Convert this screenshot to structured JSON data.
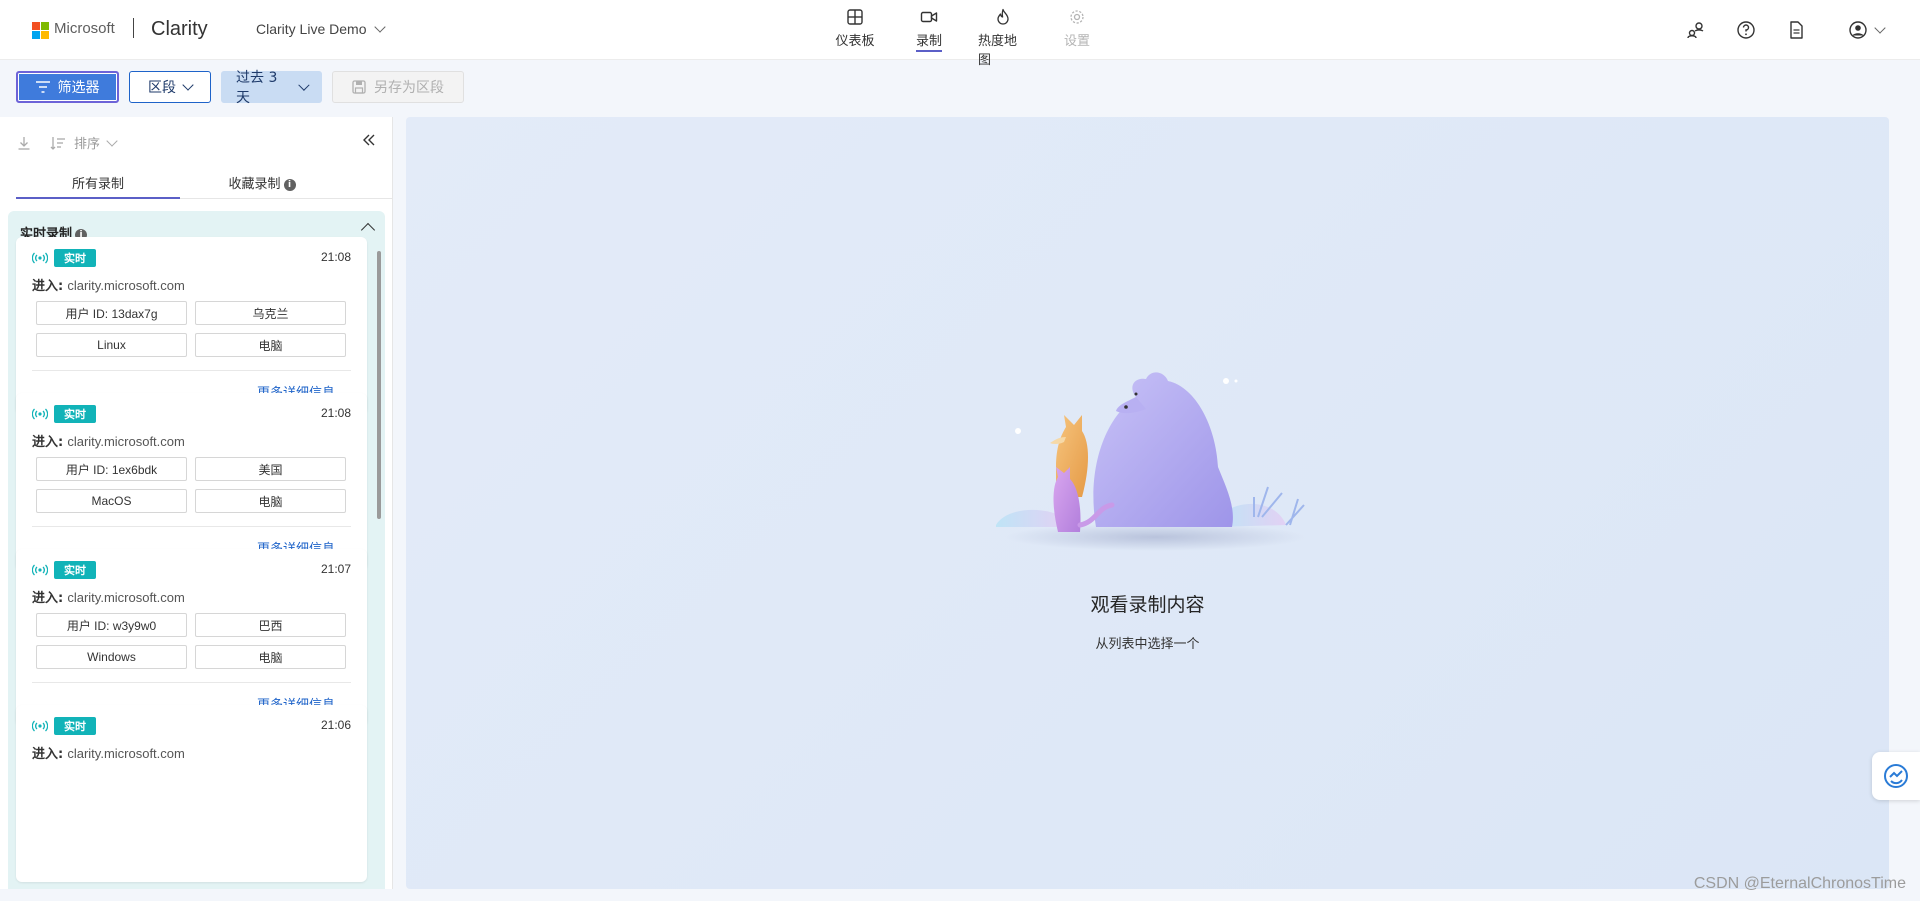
{
  "header": {
    "brand_ms": "Microsoft",
    "brand_app": "Clarity",
    "project": "Clarity Live Demo",
    "nav": [
      {
        "label": "仪表板",
        "icon": "dashboard-icon"
      },
      {
        "label": "录制",
        "icon": "video-icon",
        "active": true
      },
      {
        "label": "热度地图",
        "icon": "flame-icon"
      },
      {
        "label": "设置",
        "icon": "gear-icon",
        "disabled": true
      }
    ],
    "right_icons": [
      "share-people-icon",
      "help-icon",
      "document-icon",
      "account-icon"
    ]
  },
  "toolbar": {
    "filter_label": "筛选器",
    "segment_label": "区段",
    "range_label": "过去 3 天",
    "save_label": "另存为区段"
  },
  "sidebar": {
    "sort_label": "排序",
    "tabs": [
      {
        "label": "所有录制",
        "active": true
      },
      {
        "label": "收藏录制",
        "info": true
      }
    ],
    "live_section_title": "实时录制",
    "cards": [
      {
        "badge": "实时",
        "time": "21:08",
        "entry_label": "进入:",
        "url": "clarity.microsoft.com",
        "chips": [
          "用户 ID: 13dax7g",
          "乌克兰",
          "Linux",
          "电脑"
        ],
        "more": "更多详细信息"
      },
      {
        "badge": "实时",
        "time": "21:08",
        "entry_label": "进入:",
        "url": "clarity.microsoft.com",
        "chips": [
          "用户 ID: 1ex6bdk",
          "美国",
          "MacOS",
          "电脑"
        ],
        "more": "更多详细信息"
      },
      {
        "badge": "实时",
        "time": "21:07",
        "entry_label": "进入:",
        "url": "clarity.microsoft.com",
        "chips": [
          "用户 ID: w3y9w0",
          "巴西",
          "Windows",
          "电脑"
        ],
        "more": "更多详细信息"
      },
      {
        "badge": "实时",
        "time": "21:06",
        "entry_label": "进入:",
        "url": "clarity.microsoft.com",
        "chips": [],
        "more": ""
      }
    ]
  },
  "main": {
    "title": "观看录制内容",
    "subtitle": "从列表中选择一个"
  },
  "watermark": "CSDN @EternalChronosTime",
  "colors": {
    "accent": "#5b5fc7",
    "link": "#1e63c9",
    "live_badge": "#11b3b8",
    "filter_button": "#3f7bdc"
  }
}
